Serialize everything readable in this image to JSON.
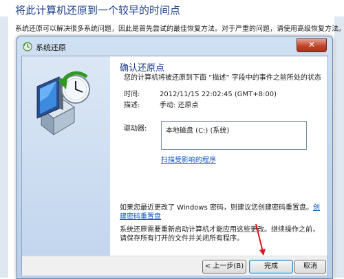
{
  "page": {
    "title": "将此计算机还原到一个较早的时间点",
    "intro": "系统还原可以解决很多系统问题，因此是首先尝试的最佳恢复方法。对于严重的问题，请使用高级恢复方法。"
  },
  "dialog": {
    "title": "系统还原",
    "close_glyph": "✕",
    "heading": "确认还原点",
    "subheading": "您的计算机将被还原到下面 “描述” 字段中的事件之前所处的状态",
    "time_label": "时间:",
    "time_value": "2012/11/15 22:02:45 (GMT+8:00)",
    "desc_label": "描述:",
    "desc_value": "手动: 还原点",
    "drives_label": "驱动器:",
    "drives": [
      "本地磁盘 (C:) (系统)"
    ],
    "scan_link": "扫描受影响的程序",
    "password_note": "如果您最近更改了 Windows 密码，则建议您创建密码重置盘。",
    "password_link": "创建密码重置盘",
    "restart_note": "系统还原需要重新启动计算机才能应用这些更改。继续操作之前，请保存所有打开的文件并关闭所有程序。",
    "buttons": {
      "back": "< 上一步(B)",
      "finish": "完成",
      "cancel": "取消"
    }
  },
  "colors": {
    "heading": "#1e3f8a",
    "link": "#0b55c4",
    "annotation_arrow": "#d8161b"
  }
}
